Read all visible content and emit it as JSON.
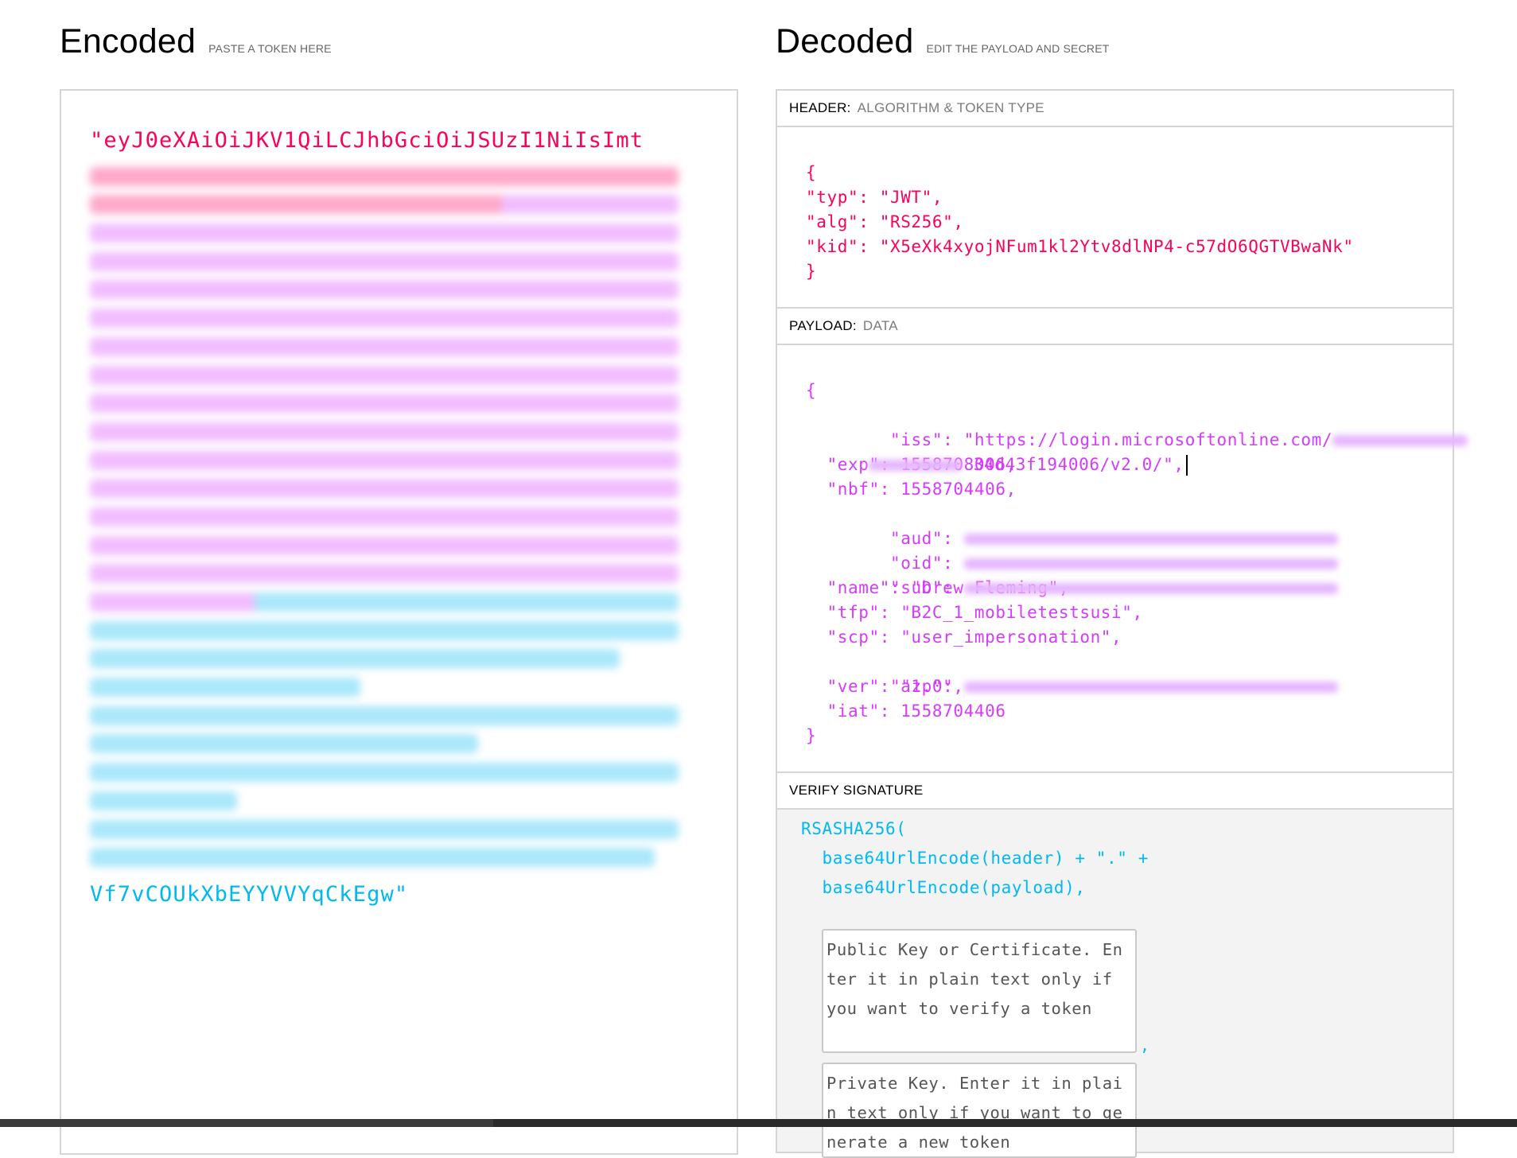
{
  "encoded": {
    "title": "Encoded",
    "subtitle": "PASTE A TOKEN HERE",
    "first_line": "\"eyJ0eXAiOiJKV1QiLCJhbGciOiJSUzI1NiIsImt",
    "last_line": "Vf7vCOUkXbEYYVVYqCkEgw\"",
    "header_color": "#fb015b",
    "payload_color": "#d63aff",
    "signature_color": "#00b9f1"
  },
  "decoded": {
    "title": "Decoded",
    "subtitle": "EDIT THE PAYLOAD AND SECRET",
    "header": {
      "label": "HEADER:",
      "desc": "ALGORITHM & TOKEN TYPE",
      "lines": [
        "{",
        "  \"typ\": \"JWT\",",
        "  \"alg\": \"RS256\",",
        "  \"kid\": \"X5eXk4xyojNFum1kl2Ytv8dlNP4-c57dO6QGTVBwaNk\"",
        "}"
      ]
    },
    "payload": {
      "label": "PAYLOAD:",
      "desc": "DATA",
      "iss_prefix": "  \"iss\": \"https://login.microsoftonline.com/",
      "iss_suffix": "34d43f194006/v2.0/\",",
      "lines": [
        "  \"exp\": 1558708006,",
        "  \"nbf\": 1558704406,"
      ],
      "redacted_keys": [
        "  \"aud\": ",
        "  \"oid\": ",
        "  \"sub\": "
      ],
      "lines2": [
        "  \"name\": \"Drew Fleming\",",
        "  \"tfp\": \"B2C_1_mobiletestsusi\",",
        "  \"scp\": \"user_impersonation\","
      ],
      "azp_key": "  \"azp\": ",
      "lines3": [
        "  \"ver\": \"1.0\",",
        "  \"iat\": 1558704406"
      ],
      "open": "{",
      "close": "}"
    },
    "verify": {
      "label": "VERIFY SIGNATURE",
      "code_lines": [
        "RSASHA256(",
        "  base64UrlEncode(header) + \".\" +",
        "  base64UrlEncode(payload),"
      ],
      "public_key_placeholder": "Public Key or Certificate. Enter it in plain text only if you want to verify a token",
      "private_key_placeholder": "Private Key. Enter it in plain text only if you want to generate a new token",
      "comma": ","
    }
  }
}
